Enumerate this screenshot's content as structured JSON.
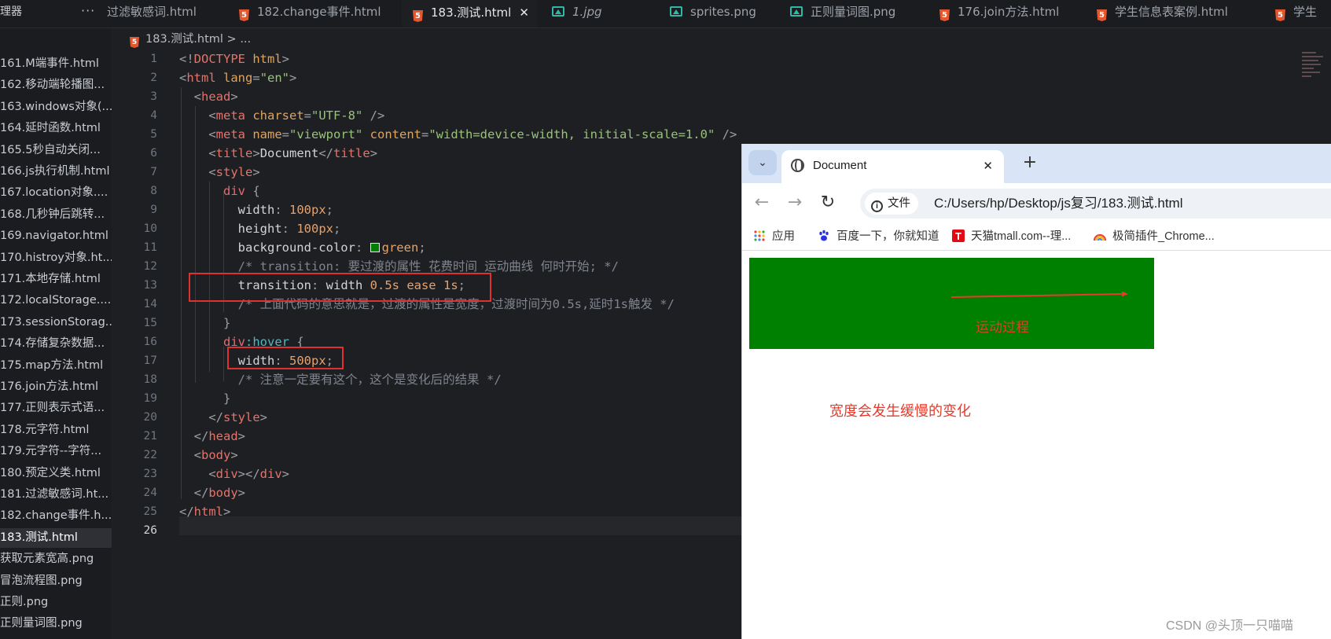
{
  "tabbar": {
    "explorer_title": "理器",
    "more_icon": "ellipsis-icon",
    "tabs": [
      {
        "label": "过滤敏感词.html",
        "icon": "html5-icon",
        "active": false
      },
      {
        "label": "182.change事件.html",
        "icon": "html5-icon",
        "active": false
      },
      {
        "label": "183.测试.html",
        "icon": "html5-icon",
        "active": true
      },
      {
        "label": "1.jpg",
        "icon": "image-icon",
        "active": false
      },
      {
        "label": "sprites.png",
        "icon": "image-icon",
        "active": false
      },
      {
        "label": "正则量词图.png",
        "icon": "image-icon",
        "active": false
      },
      {
        "label": "176.join方法.html",
        "icon": "html5-icon",
        "active": false
      },
      {
        "label": "学生信息表案例.html",
        "icon": "html5-icon",
        "active": false
      },
      {
        "label": "学生",
        "icon": "html5-icon",
        "active": false
      }
    ]
  },
  "sidebar": {
    "items": [
      {
        "label": "161.M端事件.html"
      },
      {
        "label": "162.移动端轮播图..."
      },
      {
        "label": "163.windows对象(..."
      },
      {
        "label": "164.延时函数.html"
      },
      {
        "label": "165.5秒自动关闭..."
      },
      {
        "label": "166.js执行机制.html"
      },
      {
        "label": "167.location对象...."
      },
      {
        "label": "168.几秒钟后跳转..."
      },
      {
        "label": "169.navigator.html"
      },
      {
        "label": "170.histroy对象.ht..."
      },
      {
        "label": "171.本地存储.html"
      },
      {
        "label": "172.localStorage...."
      },
      {
        "label": "173.sessionStorag..."
      },
      {
        "label": "174.存储复杂数据..."
      },
      {
        "label": "175.map方法.html"
      },
      {
        "label": "176.join方法.html"
      },
      {
        "label": "177.正则表示式语..."
      },
      {
        "label": "178.元字符.html"
      },
      {
        "label": "179.元字符--字符..."
      },
      {
        "label": "180.预定义类.html"
      },
      {
        "label": "181.过滤敏感词.ht..."
      },
      {
        "label": "182.change事件.h..."
      },
      {
        "label": "183.测试.html",
        "active": true
      },
      {
        "label": "获取元素宽高.png"
      },
      {
        "label": "冒泡流程图.png"
      },
      {
        "label": "正则.png"
      },
      {
        "label": "正则量词图.png"
      }
    ]
  },
  "editor": {
    "breadcrumb_file": "183.测试.html",
    "breadcrumb_sep": ">",
    "breadcrumb_more": "...",
    "line_numbers": [
      "1",
      "2",
      "3",
      "4",
      "5",
      "6",
      "7",
      "8",
      "9",
      "10",
      "11",
      "12",
      "13",
      "14",
      "15",
      "16",
      "17",
      "18",
      "19",
      "20",
      "21",
      "22",
      "23",
      "24",
      "25",
      "26"
    ],
    "current_line": "26",
    "lines": [
      [
        [
          "t-punc",
          "<!"
        ],
        [
          "t-tag",
          "DOCTYPE"
        ],
        [
          "t-attr",
          " html"
        ],
        [
          "t-punc",
          ">"
        ]
      ],
      [
        [
          "t-punc",
          "<"
        ],
        [
          "t-tag",
          "html"
        ],
        [
          "t-attr",
          " lang"
        ],
        [
          "t-punc",
          "="
        ],
        [
          "t-str",
          "\"en\""
        ],
        [
          "t-punc",
          ">"
        ]
      ],
      [
        [
          "",
          "  "
        ],
        [
          "t-punc",
          "<"
        ],
        [
          "t-tag",
          "head"
        ],
        [
          "t-punc",
          ">"
        ]
      ],
      [
        [
          "",
          "    "
        ],
        [
          "t-punc",
          "<"
        ],
        [
          "t-tag",
          "meta"
        ],
        [
          "t-attr",
          " charset"
        ],
        [
          "t-punc",
          "="
        ],
        [
          "t-str",
          "\"UTF-8\""
        ],
        [
          "t-punc",
          " />"
        ]
      ],
      [
        [
          "",
          "    "
        ],
        [
          "t-punc",
          "<"
        ],
        [
          "t-tag",
          "meta"
        ],
        [
          "t-attr",
          " name"
        ],
        [
          "t-punc",
          "="
        ],
        [
          "t-str",
          "\"viewport\""
        ],
        [
          "t-attr",
          " content"
        ],
        [
          "t-punc",
          "="
        ],
        [
          "t-str",
          "\"width=device-width, initial-scale=1.0\""
        ],
        [
          "t-punc",
          " />"
        ]
      ],
      [
        [
          "",
          "    "
        ],
        [
          "t-punc",
          "<"
        ],
        [
          "t-tag",
          "title"
        ],
        [
          "t-punc",
          ">"
        ],
        [
          "t-prop",
          "Document"
        ],
        [
          "t-punc",
          "</"
        ],
        [
          "t-tag",
          "title"
        ],
        [
          "t-punc",
          ">"
        ]
      ],
      [
        [
          "",
          "    "
        ],
        [
          "t-punc",
          "<"
        ],
        [
          "t-tag",
          "style"
        ],
        [
          "t-punc",
          ">"
        ]
      ],
      [
        [
          "",
          "      "
        ],
        [
          "t-sel",
          "div"
        ],
        [
          "t-punc",
          " {"
        ]
      ],
      [
        [
          "",
          "        "
        ],
        [
          "t-prop",
          "width"
        ],
        [
          "t-punc",
          ": "
        ],
        [
          "t-num",
          "100px"
        ],
        [
          "t-punc",
          ";"
        ]
      ],
      [
        [
          "",
          "        "
        ],
        [
          "t-prop",
          "height"
        ],
        [
          "t-punc",
          ": "
        ],
        [
          "t-num",
          "100px"
        ],
        [
          "t-punc",
          ";"
        ]
      ],
      [
        [
          "",
          "        "
        ],
        [
          "t-prop",
          "background-color"
        ],
        [
          "t-punc",
          ": "
        ],
        [
          "swatch",
          ""
        ],
        [
          "t-val",
          "green"
        ],
        [
          "t-punc",
          ";"
        ]
      ],
      [
        [
          "",
          "        "
        ],
        [
          "t-cmt",
          "/* transition: 要过渡的属性 花费时间 运动曲线 何时开始; */"
        ]
      ],
      [
        [
          "",
          "        "
        ],
        [
          "t-prop",
          "transition"
        ],
        [
          "t-punc",
          ": "
        ],
        [
          "t-prop",
          "width "
        ],
        [
          "t-num",
          "0.5s"
        ],
        [
          "t-val",
          " ease "
        ],
        [
          "t-num",
          "1s"
        ],
        [
          "t-punc",
          ";"
        ]
      ],
      [
        [
          "",
          "        "
        ],
        [
          "t-cmt",
          "/* 上面代码的意思就是，过渡的属性是宽度，过渡时间为0.5s,延时1s触发 */"
        ]
      ],
      [
        [
          "",
          "      "
        ],
        [
          "t-punc",
          "}"
        ]
      ],
      [
        [
          "",
          "      "
        ],
        [
          "t-sel",
          "div"
        ],
        [
          "t-pseudo",
          ":hover"
        ],
        [
          "t-punc",
          " {"
        ]
      ],
      [
        [
          "",
          "        "
        ],
        [
          "t-prop",
          "width"
        ],
        [
          "t-punc",
          ": "
        ],
        [
          "t-num",
          "500px"
        ],
        [
          "t-punc",
          ";"
        ]
      ],
      [
        [
          "",
          "        "
        ],
        [
          "t-cmt",
          "/* 注意一定要有这个，这个是变化后的结果 */"
        ]
      ],
      [
        [
          "",
          "      "
        ],
        [
          "t-punc",
          "}"
        ]
      ],
      [
        [
          "",
          "    "
        ],
        [
          "t-punc",
          "</"
        ],
        [
          "t-tag",
          "style"
        ],
        [
          "t-punc",
          ">"
        ]
      ],
      [
        [
          "",
          "  "
        ],
        [
          "t-punc",
          "</"
        ],
        [
          "t-tag",
          "head"
        ],
        [
          "t-punc",
          ">"
        ]
      ],
      [
        [
          "",
          "  "
        ],
        [
          "t-punc",
          "<"
        ],
        [
          "t-tag",
          "body"
        ],
        [
          "t-punc",
          ">"
        ]
      ],
      [
        [
          "",
          "    "
        ],
        [
          "t-punc",
          "<"
        ],
        [
          "t-tag",
          "div"
        ],
        [
          "t-punc",
          "></"
        ],
        [
          "t-tag",
          "div"
        ],
        [
          "t-punc",
          ">"
        ]
      ],
      [
        [
          "",
          "  "
        ],
        [
          "t-punc",
          "</"
        ],
        [
          "t-tag",
          "body"
        ],
        [
          "t-punc",
          ">"
        ]
      ],
      [
        [
          "t-punc",
          "</"
        ],
        [
          "t-tag",
          "html"
        ],
        [
          "t-punc",
          ">"
        ]
      ],
      [
        [
          "",
          ""
        ]
      ]
    ]
  },
  "browser": {
    "tab_title": "Document",
    "tab_close": "✕",
    "new_tab": "+",
    "dropdown_icon": "chevron-down-icon",
    "back": "←",
    "forward": "→",
    "reload": "↻",
    "security_chip": "文件",
    "url": "C:/Users/hp/Desktop/js复习/183.测试.html",
    "bookmarks": [
      {
        "label": "应用",
        "icon": "apps-grid-icon"
      },
      {
        "label": "百度一下，你就知道",
        "icon": "baidu-paw-icon"
      },
      {
        "label": "天猫tmall.com--理...",
        "icon": "tmall-icon"
      },
      {
        "label": "极简插件_Chrome...",
        "icon": "rainbow-icon"
      }
    ],
    "demo_color": "#008000",
    "annotation_motion": "运动过程",
    "annotation_width": "宽度会发生缓慢的变化"
  },
  "watermark": "CSDN @头顶一只喵喵",
  "colors": {
    "editor_bg": "#1e1f22",
    "highlight_red": "#e03131",
    "demo_green": "#008000"
  }
}
